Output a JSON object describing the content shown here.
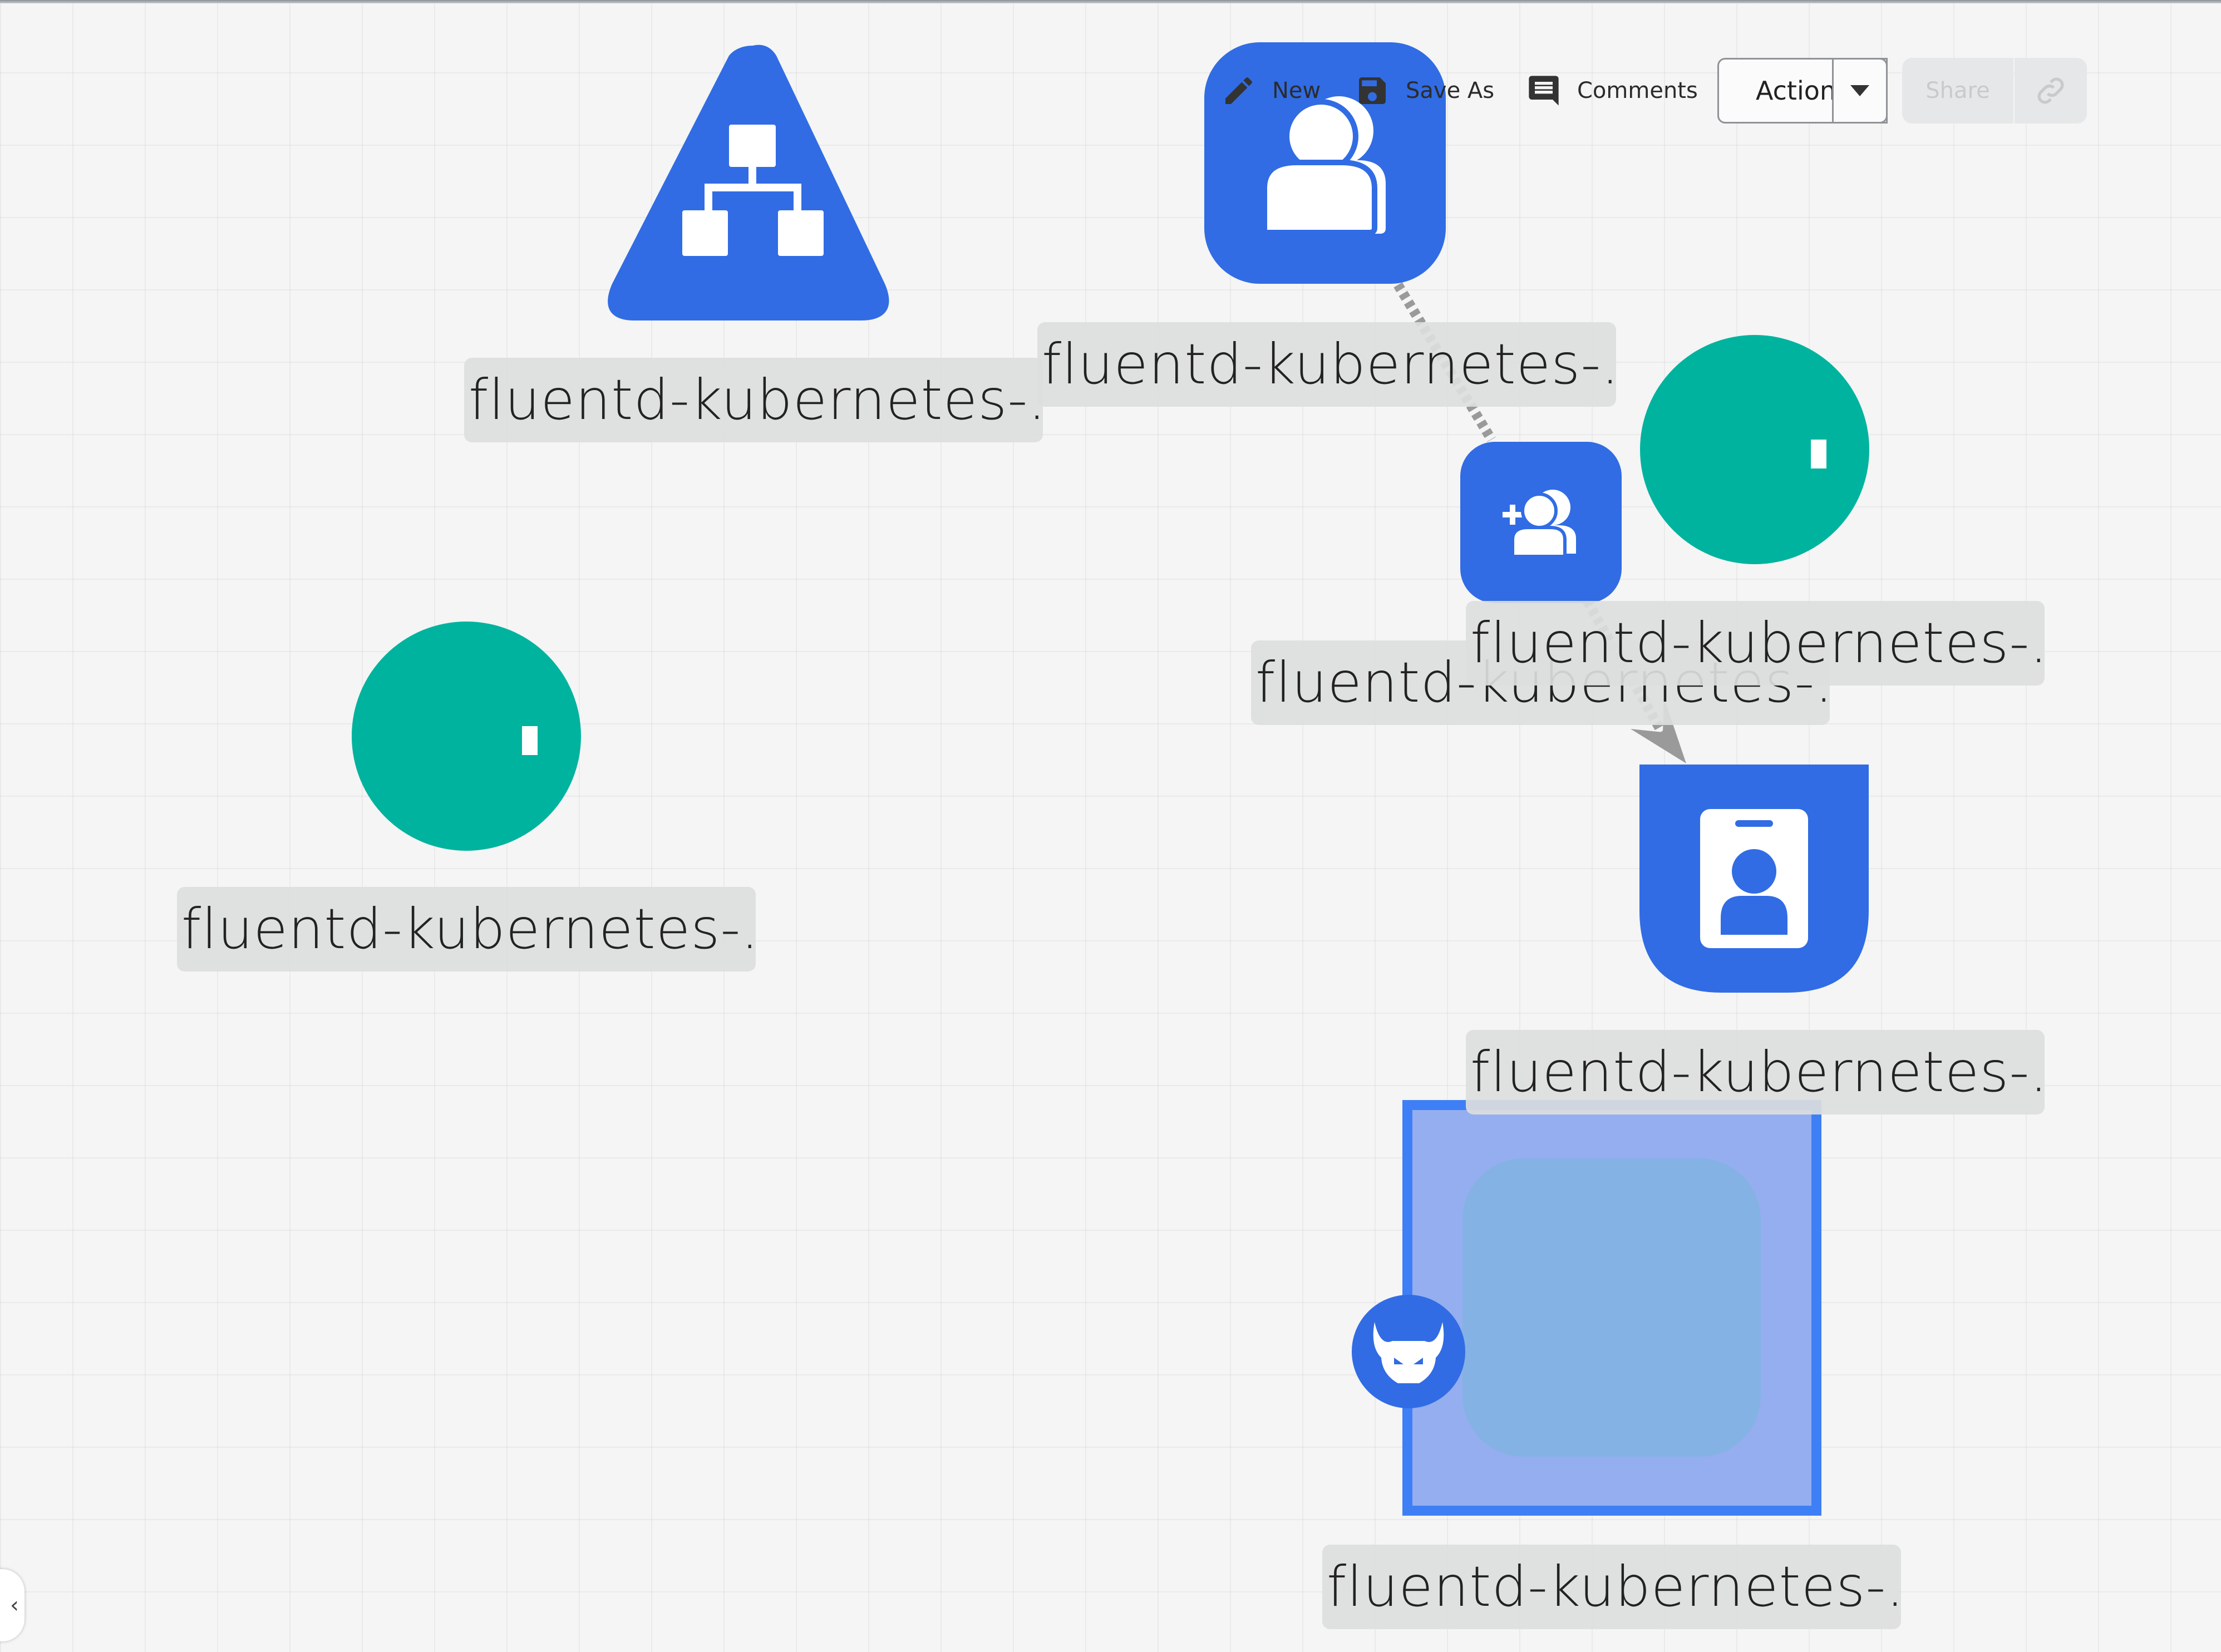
{
  "toolbar": {
    "new_label": "New",
    "save_as_label": "Save As",
    "comments_label": "Comments",
    "actions_label": "Actions",
    "share_label": "Share"
  },
  "colors": {
    "node_blue": "#316ce4",
    "node_teal": "#00b39f",
    "selection_fill": "#94aef0",
    "selection_border": "#3f7ff5",
    "edge_gray": "#9a9a9a"
  },
  "nodes": [
    {
      "id": "triangle-network",
      "icon": "network-hierarchy-icon",
      "label": "fluentd-kubernetes-..."
    },
    {
      "id": "users-group",
      "icon": "users-icon",
      "label": "fluentd-kubernetes-..."
    },
    {
      "id": "add-user",
      "icon": "add-user-icon",
      "label": "fluentd-kubernetes-..."
    },
    {
      "id": "teal-circle-right",
      "icon": "circle-node-icon",
      "label": "fluentd-kubernetes-..."
    },
    {
      "id": "teal-circle-left",
      "icon": "circle-node-icon",
      "label": "fluentd-kubernetes-..."
    },
    {
      "id": "id-badge",
      "icon": "id-badge-icon",
      "label": "fluentd-kubernetes-..."
    },
    {
      "id": "namespace-group",
      "icon": "devil-icon",
      "label": "fluentd-kubernetes-..."
    }
  ]
}
